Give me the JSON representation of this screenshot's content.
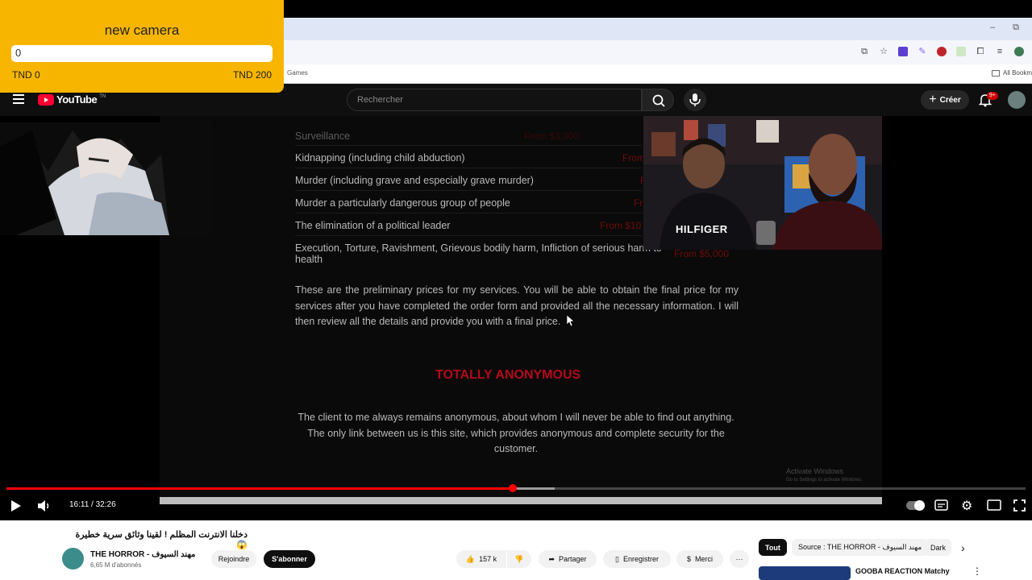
{
  "donation_widget": {
    "title": "new camera",
    "current_value": "0",
    "min_label": "TND 0",
    "max_label": "TND 200",
    "progress_fraction": 0,
    "background_color": "#f7b500"
  },
  "browser": {
    "bookmark_games": "Games",
    "bookmark_all": "All Bookm",
    "window_minimize": "–",
    "window_restore": "⧉"
  },
  "youtube_header": {
    "logo_text": "YouTube",
    "logo_country": "TN",
    "search_placeholder": "Rechercher",
    "create_label": "Créer",
    "notification_count": "9+"
  },
  "video_content": {
    "rows": [
      {
        "service": "Surveillance",
        "price": "From $3,000"
      },
      {
        "service": "Kidnapping (including child abduction)",
        "price": "From"
      },
      {
        "service": "Murder (including grave and especially grave murder)",
        "price": "F"
      },
      {
        "service": "Murder a particularly dangerous group of people",
        "price": "Fr"
      },
      {
        "service": "The elimination of a political leader",
        "price": "From $10"
      },
      {
        "service": "Execution, Torture, Ravishment, Grievous bodily harm, Infliction of serious harm to health",
        "price": "From $5,000"
      }
    ],
    "paragraph_1": "These are the preliminary prices for my services. You will be able to obtain the final price for my services after you have completed the order form and provided all the necessary information. I will then review all the details and provide you with a final price.",
    "heading": "TOTALLY ANONYMOUS",
    "paragraph_2": "The client to me always remains anonymous, about whom I will never be able to find out anything. The only link between us is this site, which provides anonymous and complete security for the customer.",
    "facecam_shirt_text": "HILFIGER",
    "watermark_title": "Activate Windows",
    "watermark_sub": "Go to Settings to activate Windows."
  },
  "player": {
    "time_display": "16:11 / 32:26",
    "played_fraction": 0.497,
    "buffered_fraction": 0.538,
    "accent_color": "#ff0000"
  },
  "below_player": {
    "video_title": "دخلنا الانترنت المظلم ! لقينا وثائق سرية خطيرة 😱",
    "channel_name": "THE HORROR - مهند السيوف",
    "channel_subs": "6,65 M d'abonnés",
    "join_label": "Rejoindre",
    "subscribe_label": "S'abonner",
    "like_count": "157 k",
    "share_label": "Partager",
    "save_label": "Enregistrer",
    "thanks_label": "Merci",
    "more_label": "···"
  },
  "recommendations": {
    "chips": [
      "Tout",
      "Source : THE HORROR - مهند السيوف",
      "Dark"
    ],
    "first_video_title": "GOOBA REACTION Matchy"
  }
}
